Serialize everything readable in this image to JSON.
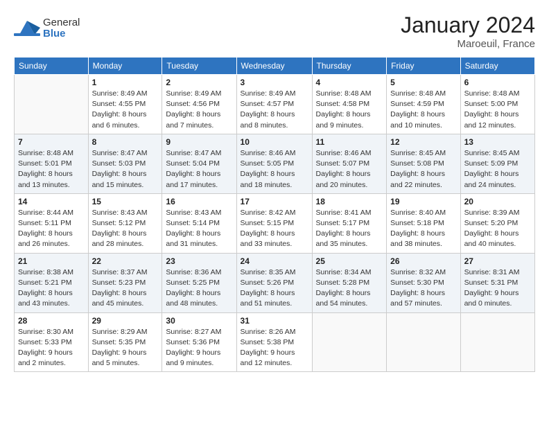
{
  "header": {
    "logo_general": "General",
    "logo_blue": "Blue",
    "month": "January 2024",
    "location": "Maroeuil, France"
  },
  "weekdays": [
    "Sunday",
    "Monday",
    "Tuesday",
    "Wednesday",
    "Thursday",
    "Friday",
    "Saturday"
  ],
  "weeks": [
    [
      {
        "day": "",
        "info": ""
      },
      {
        "day": "1",
        "info": "Sunrise: 8:49 AM\nSunset: 4:55 PM\nDaylight: 8 hours\nand 6 minutes."
      },
      {
        "day": "2",
        "info": "Sunrise: 8:49 AM\nSunset: 4:56 PM\nDaylight: 8 hours\nand 7 minutes."
      },
      {
        "day": "3",
        "info": "Sunrise: 8:49 AM\nSunset: 4:57 PM\nDaylight: 8 hours\nand 8 minutes."
      },
      {
        "day": "4",
        "info": "Sunrise: 8:48 AM\nSunset: 4:58 PM\nDaylight: 8 hours\nand 9 minutes."
      },
      {
        "day": "5",
        "info": "Sunrise: 8:48 AM\nSunset: 4:59 PM\nDaylight: 8 hours\nand 10 minutes."
      },
      {
        "day": "6",
        "info": "Sunrise: 8:48 AM\nSunset: 5:00 PM\nDaylight: 8 hours\nand 12 minutes."
      }
    ],
    [
      {
        "day": "7",
        "info": "Sunrise: 8:48 AM\nSunset: 5:01 PM\nDaylight: 8 hours\nand 13 minutes."
      },
      {
        "day": "8",
        "info": "Sunrise: 8:47 AM\nSunset: 5:03 PM\nDaylight: 8 hours\nand 15 minutes."
      },
      {
        "day": "9",
        "info": "Sunrise: 8:47 AM\nSunset: 5:04 PM\nDaylight: 8 hours\nand 17 minutes."
      },
      {
        "day": "10",
        "info": "Sunrise: 8:46 AM\nSunset: 5:05 PM\nDaylight: 8 hours\nand 18 minutes."
      },
      {
        "day": "11",
        "info": "Sunrise: 8:46 AM\nSunset: 5:07 PM\nDaylight: 8 hours\nand 20 minutes."
      },
      {
        "day": "12",
        "info": "Sunrise: 8:45 AM\nSunset: 5:08 PM\nDaylight: 8 hours\nand 22 minutes."
      },
      {
        "day": "13",
        "info": "Sunrise: 8:45 AM\nSunset: 5:09 PM\nDaylight: 8 hours\nand 24 minutes."
      }
    ],
    [
      {
        "day": "14",
        "info": "Sunrise: 8:44 AM\nSunset: 5:11 PM\nDaylight: 8 hours\nand 26 minutes."
      },
      {
        "day": "15",
        "info": "Sunrise: 8:43 AM\nSunset: 5:12 PM\nDaylight: 8 hours\nand 28 minutes."
      },
      {
        "day": "16",
        "info": "Sunrise: 8:43 AM\nSunset: 5:14 PM\nDaylight: 8 hours\nand 31 minutes."
      },
      {
        "day": "17",
        "info": "Sunrise: 8:42 AM\nSunset: 5:15 PM\nDaylight: 8 hours\nand 33 minutes."
      },
      {
        "day": "18",
        "info": "Sunrise: 8:41 AM\nSunset: 5:17 PM\nDaylight: 8 hours\nand 35 minutes."
      },
      {
        "day": "19",
        "info": "Sunrise: 8:40 AM\nSunset: 5:18 PM\nDaylight: 8 hours\nand 38 minutes."
      },
      {
        "day": "20",
        "info": "Sunrise: 8:39 AM\nSunset: 5:20 PM\nDaylight: 8 hours\nand 40 minutes."
      }
    ],
    [
      {
        "day": "21",
        "info": "Sunrise: 8:38 AM\nSunset: 5:21 PM\nDaylight: 8 hours\nand 43 minutes."
      },
      {
        "day": "22",
        "info": "Sunrise: 8:37 AM\nSunset: 5:23 PM\nDaylight: 8 hours\nand 45 minutes."
      },
      {
        "day": "23",
        "info": "Sunrise: 8:36 AM\nSunset: 5:25 PM\nDaylight: 8 hours\nand 48 minutes."
      },
      {
        "day": "24",
        "info": "Sunrise: 8:35 AM\nSunset: 5:26 PM\nDaylight: 8 hours\nand 51 minutes."
      },
      {
        "day": "25",
        "info": "Sunrise: 8:34 AM\nSunset: 5:28 PM\nDaylight: 8 hours\nand 54 minutes."
      },
      {
        "day": "26",
        "info": "Sunrise: 8:32 AM\nSunset: 5:30 PM\nDaylight: 8 hours\nand 57 minutes."
      },
      {
        "day": "27",
        "info": "Sunrise: 8:31 AM\nSunset: 5:31 PM\nDaylight: 9 hours\nand 0 minutes."
      }
    ],
    [
      {
        "day": "28",
        "info": "Sunrise: 8:30 AM\nSunset: 5:33 PM\nDaylight: 9 hours\nand 2 minutes."
      },
      {
        "day": "29",
        "info": "Sunrise: 8:29 AM\nSunset: 5:35 PM\nDaylight: 9 hours\nand 5 minutes."
      },
      {
        "day": "30",
        "info": "Sunrise: 8:27 AM\nSunset: 5:36 PM\nDaylight: 9 hours\nand 9 minutes."
      },
      {
        "day": "31",
        "info": "Sunrise: 8:26 AM\nSunset: 5:38 PM\nDaylight: 9 hours\nand 12 minutes."
      },
      {
        "day": "",
        "info": ""
      },
      {
        "day": "",
        "info": ""
      },
      {
        "day": "",
        "info": ""
      }
    ]
  ]
}
